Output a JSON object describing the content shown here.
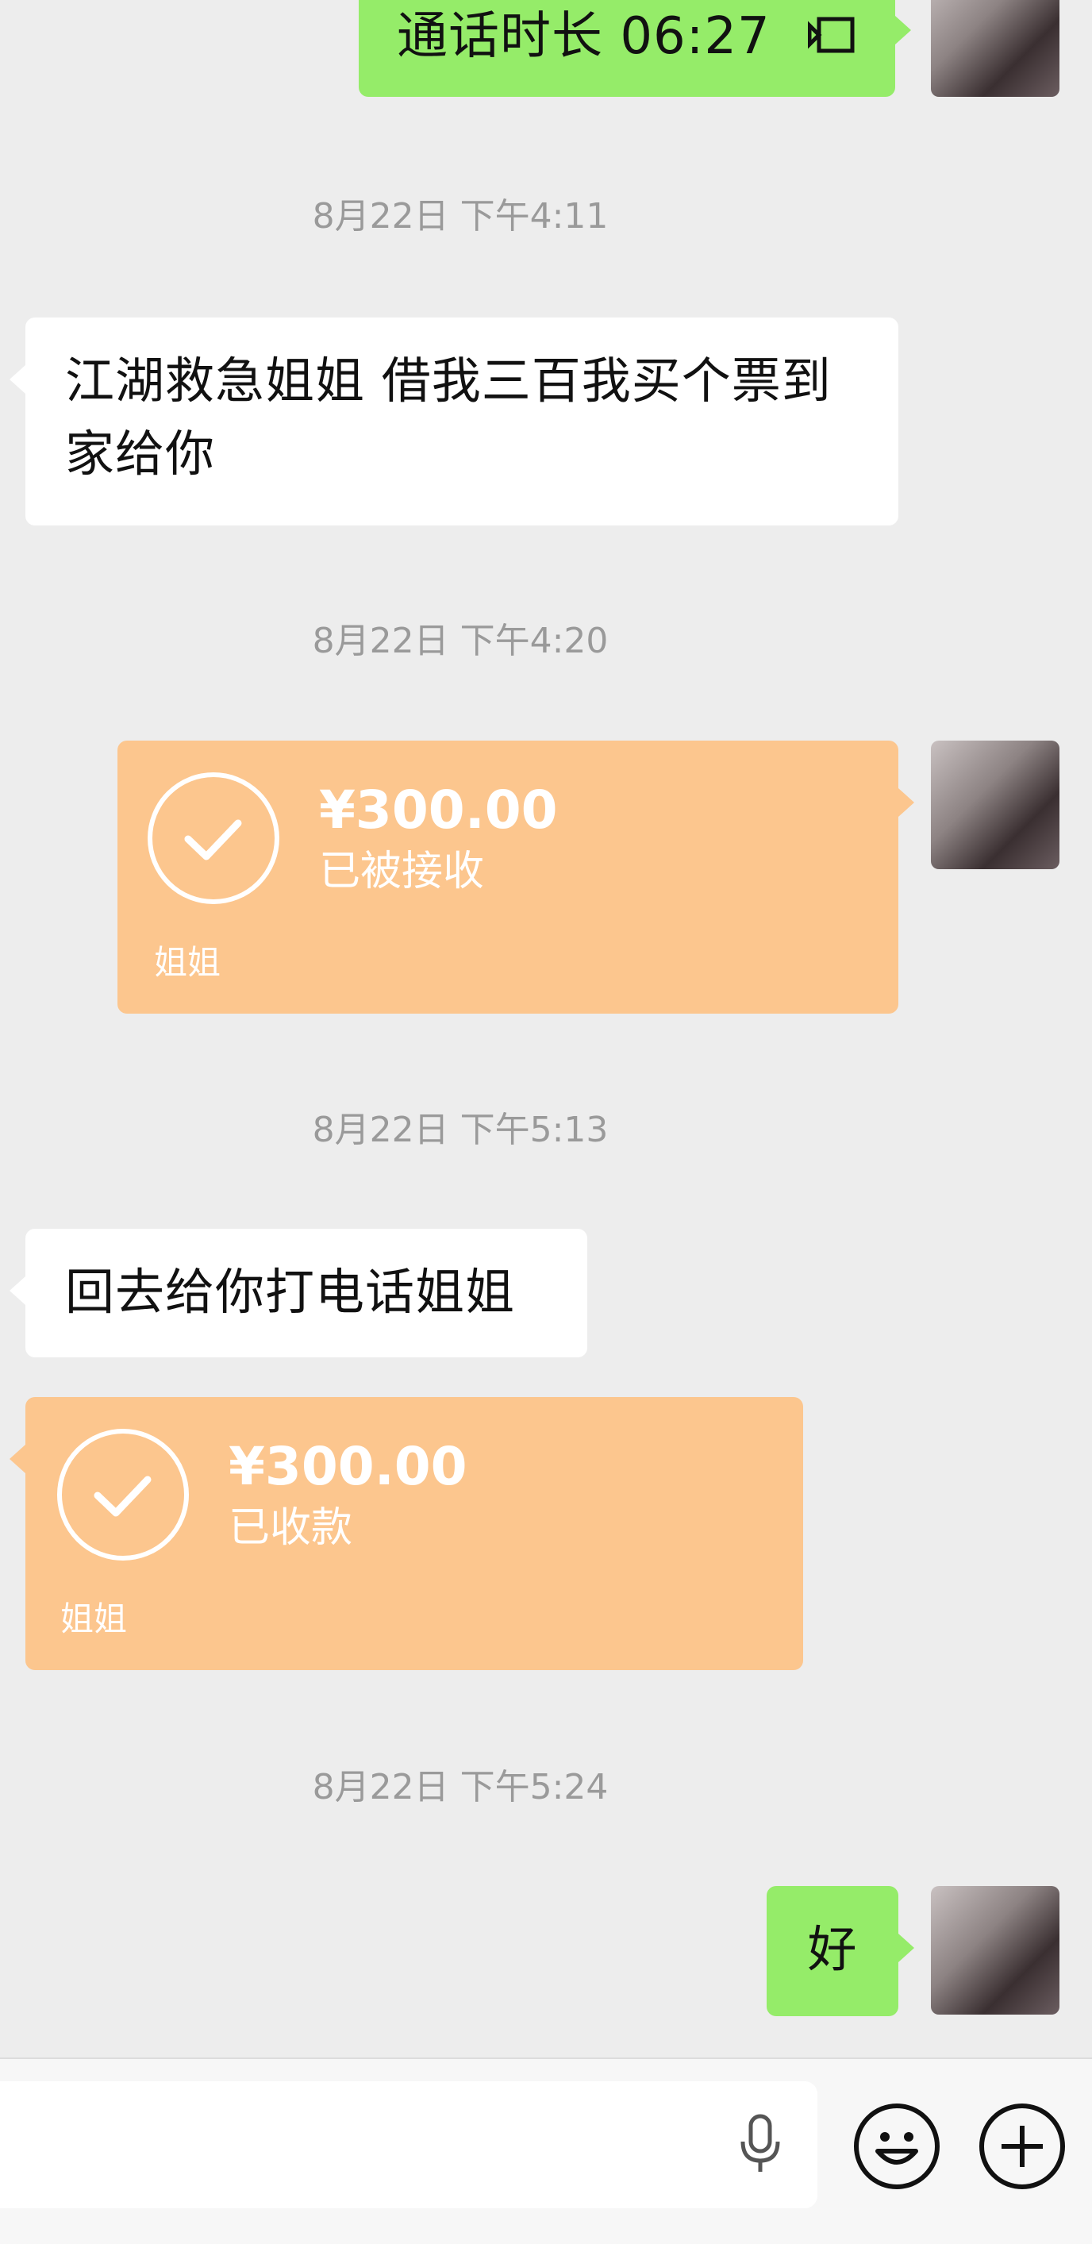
{
  "messages": {
    "call_duration": {
      "text": "通话时长 06:27",
      "icon": "video-call-icon"
    },
    "ts1": "8月22日 下午4:11",
    "borrow_request": "江湖救急姐姐 借我三百我买个票到家给你",
    "ts2": "8月22日 下午4:20",
    "transfer_sent": {
      "amount": "¥300.00",
      "status": "已被接收",
      "footer": "姐姐"
    },
    "ts3": "8月22日 下午5:13",
    "callback": "回去给你打电话姐姐",
    "transfer_received": {
      "amount": "¥300.00",
      "status": "已收款",
      "footer": "姐姐"
    },
    "ts4": "8月22日 下午5:24",
    "ok_reply": "好"
  },
  "input_bar": {
    "voice_icon": "microphone-icon",
    "emoji_icon": "emoji-smile-icon",
    "more_icon": "plus-icon"
  },
  "colors": {
    "background": "#ededed",
    "bubble_green": "#95ec69",
    "bubble_white": "#ffffff",
    "transfer_orange": "#fcc68e",
    "timestamp_gray": "#9a9a9a"
  }
}
